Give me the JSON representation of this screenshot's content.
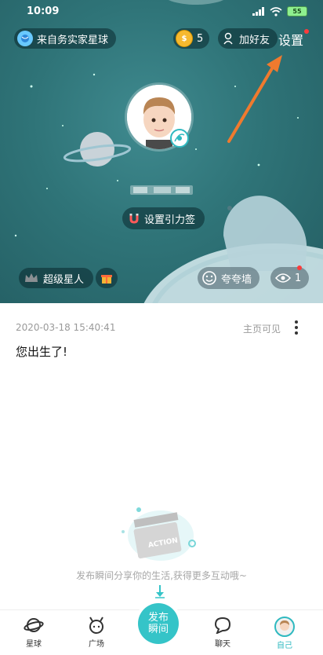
{
  "status": {
    "time": "10:09",
    "battery": "55"
  },
  "header": {
    "origin_label": "来自务实家星球",
    "coin_count": "5",
    "add_friend_label": "加好友",
    "settings_label": "设置"
  },
  "profile": {
    "tag_button_label": "设置引力签"
  },
  "actions": {
    "super_star_label": "超级星人",
    "praise_wall_label": "夸夸墙",
    "view_count": "1"
  },
  "post": {
    "timestamp": "2020-03-18 15:40:41",
    "visibility": "主页可见",
    "text": "您出生了!"
  },
  "empty_state": {
    "art_label": "ACTION",
    "message": "发布瞬间分享你的生活,获得更多互动哦~"
  },
  "tabbar": {
    "planet": "星球",
    "square": "广场",
    "publish_line1": "发布",
    "publish_line2": "瞬间",
    "chat": "聊天",
    "me": "自己"
  },
  "colors": {
    "accent": "#35c4c8",
    "hero_bg": "#2f7478",
    "arrow": "#f07a2e"
  }
}
